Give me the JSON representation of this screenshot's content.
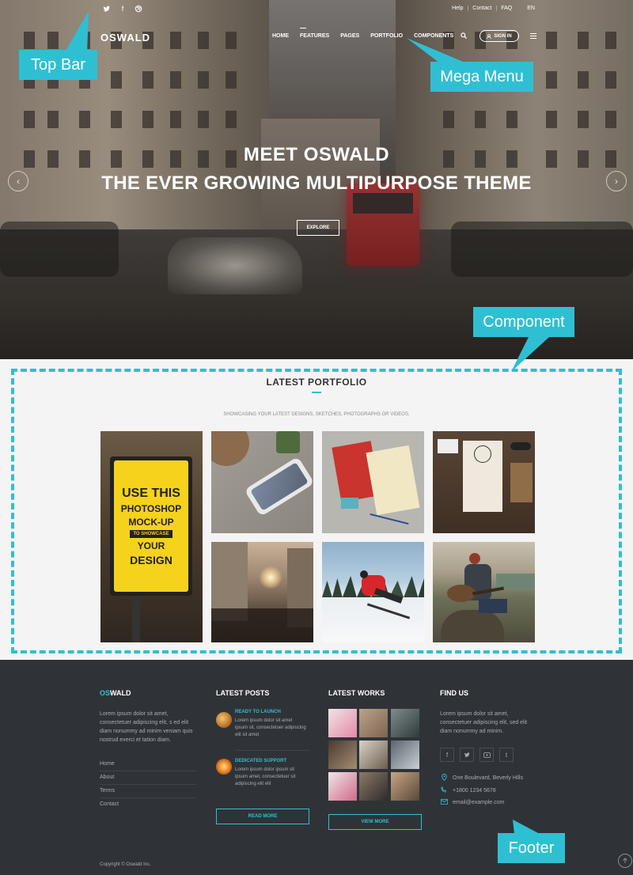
{
  "topbar": {
    "social_icons": [
      "twitter-icon",
      "facebook-icon",
      "dribbble-icon"
    ],
    "links": [
      "Help",
      "Contact",
      "FAQ"
    ],
    "language": "EN"
  },
  "navbar": {
    "logo": "OSWALD",
    "items": [
      "HOME",
      "FEATURES",
      "PAGES",
      "PORTFOLIO",
      "COMPONENTS"
    ],
    "signin": "SIGN IN"
  },
  "hero": {
    "title_line1": "MEET OSWALD",
    "title_line2": "THE EVER GROWING MULTIPURPOSE THEME",
    "button": "EXPLORE"
  },
  "callouts": {
    "top_bar": "Top Bar",
    "mega_menu": "Mega Menu",
    "component": "Component",
    "footer": "Footer"
  },
  "portfolio": {
    "title": "LATEST PORTFOLIO",
    "subtitle": "SHOWCASING YOUR LATEST DESIGNS, SKETCHES, PHOTOGRAPHS OR VIDEOS.",
    "poster_lines": [
      "USE THIS",
      "PHOTOSHOP",
      "MOCK-UP",
      "TO SHOWCASE",
      "YOUR",
      "DESIGN"
    ]
  },
  "footer": {
    "brand_prefix": "OS",
    "brand_suffix": "WALD",
    "about": "Lorem ipsum dolor sit amet, consectetuer adipiscing elit, s ed elit diam nonummy ad minim veniam quis nostrud exerci et tation diam.",
    "links": [
      "Home",
      "About",
      "Terms",
      "Contact"
    ],
    "posts_heading": "LATEST POSTS",
    "posts": [
      {
        "title": "READY TO LAUNCH",
        "text": "Lorem ipsum dolor sit amet ipsum sit, consectetuer adipiscing elit sit amet"
      },
      {
        "title": "DEDICATED SUPPORT",
        "text": "Lorem ipsum dolor ipsum sit ipsum amet, consectetuer sit adipiscing elit elit"
      }
    ],
    "read_more": "READ MORE",
    "works_heading": "LATEST WORKS",
    "view_more": "VIEW MORE",
    "find_heading": "FIND US",
    "find_text": "Lorem ipsum dolor sit amet, consectetuer adipiscing elit, sed elit diam nonummy ad minim.",
    "social_icons": [
      "facebook-icon",
      "twitter-icon",
      "youtube-icon",
      "tumblr-icon"
    ],
    "address": "One Boulevard, Beverly Hills",
    "phone": "+1800 1234 5678",
    "email": "email@example.com",
    "copyright": "Copyright © Oswald Inc."
  }
}
